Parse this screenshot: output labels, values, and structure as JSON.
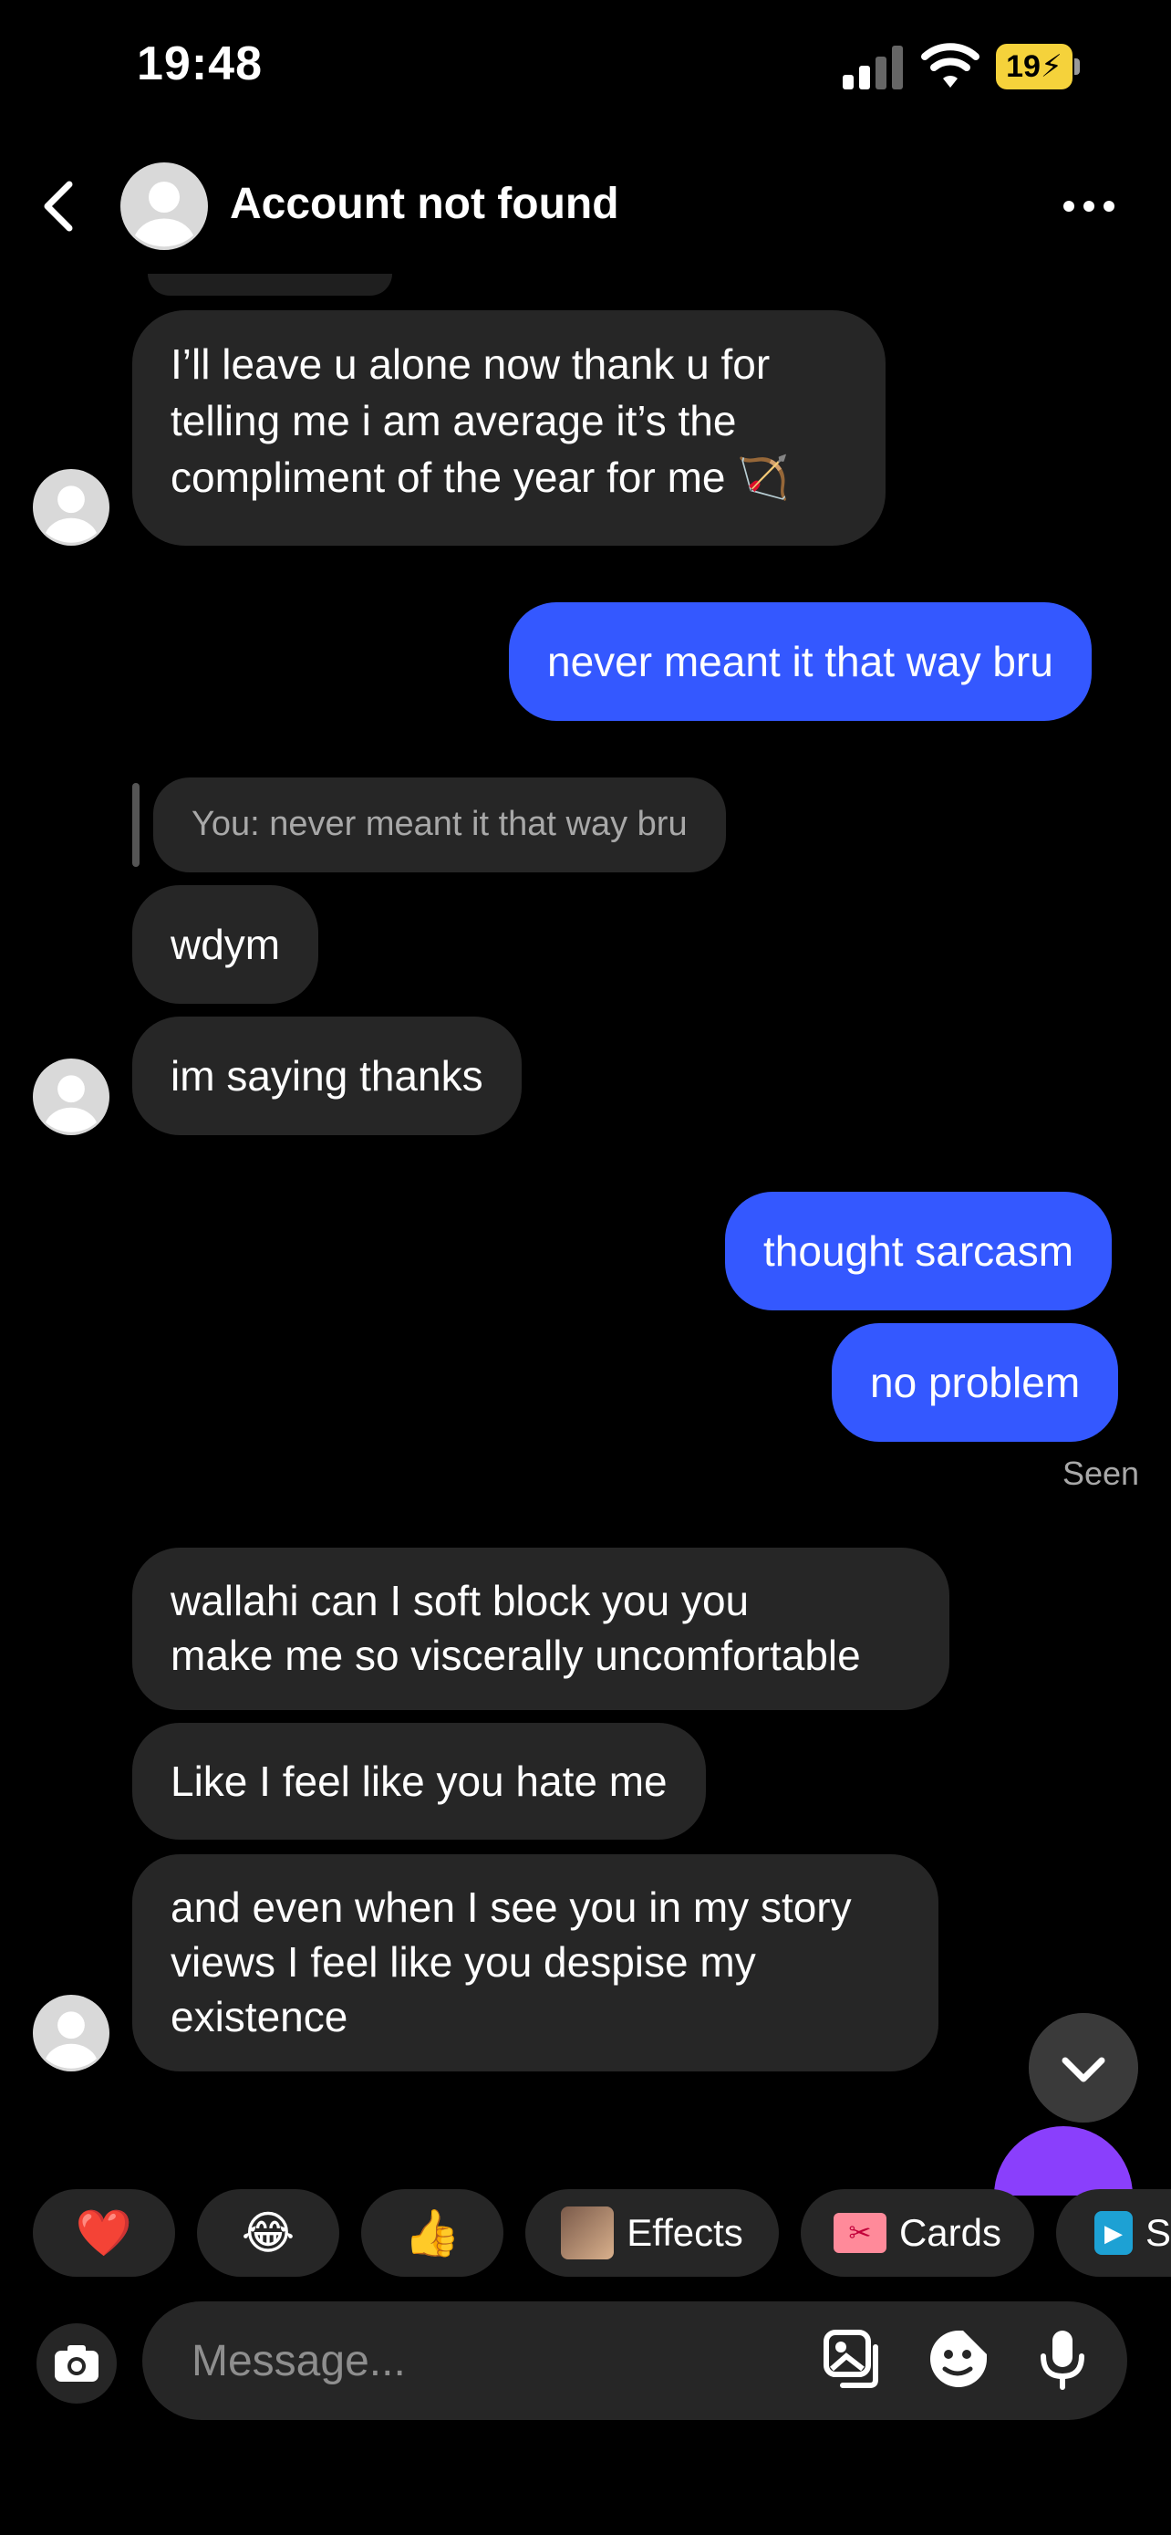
{
  "status_bar": {
    "time": "19:48",
    "battery": "19"
  },
  "header": {
    "title": "Account not found"
  },
  "messages": {
    "m1": [
      "I’ll leave u alone now thank u for",
      "telling me i am average it’s the",
      "compliment of the year for me 🏹"
    ],
    "m2": "never meant it that way bru",
    "m3_reply": "You: never meant it that way bru",
    "m4": "wdym",
    "m5": "im saying thanks",
    "m6": "thought sarcasm",
    "m7": "no problem",
    "seen": "Seen",
    "m8": [
      "wallahi can I soft block you you",
      "make me so viscerally uncomfortable"
    ],
    "m9": "Like I feel like you hate me",
    "m10": [
      "and even when I see you in my story",
      "views I feel like you despise my",
      "existence"
    ]
  },
  "quick_reactions": [
    {
      "emoji": "❤️",
      "icon": "heart-icon"
    },
    {
      "emoji": "😂",
      "icon": "laughing-emoji-icon"
    },
    {
      "emoji": "👍",
      "icon": "thumbs-up-icon"
    }
  ],
  "actions": {
    "effects": "Effects",
    "cards": "Cards",
    "third_partial": "S"
  },
  "composer": {
    "placeholder": "Message..."
  },
  "colors": {
    "outgoing": "#3458ff",
    "incoming": "#262626",
    "background": "#000000"
  }
}
